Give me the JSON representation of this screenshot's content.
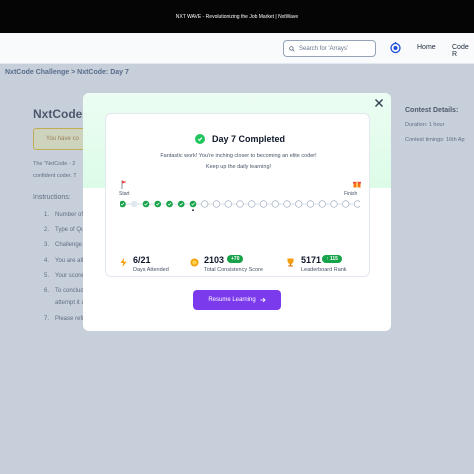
{
  "topbar": {
    "text": "NXT WAVE - Revolutionizing the Job Market | NxtWave"
  },
  "navbar": {
    "search_placeholder": "Search for 'Arrays'",
    "links": [
      "Home",
      "Code R"
    ]
  },
  "breadcrumb": "NxtCode Challenge > NxtCode: Day 7",
  "page": {
    "title": "NxtCode:",
    "notice": "You have co",
    "paragraph": [
      "The \"NxtCode - 2",
      "confident coder. T"
    ],
    "instructions_title": "Instructions:",
    "instructions": [
      {
        "n": "1.",
        "text": "Number of Qu"
      },
      {
        "n": "2.",
        "text": "Type of Ques"
      },
      {
        "n": "3.",
        "text": "Challenge Tim"
      },
      {
        "n": "4.",
        "text": "You are allow"
      },
      {
        "n": "5.",
        "text": "Your score wi"
      },
      {
        "n": "6.",
        "text": "To conclude t"
      },
      {
        "n": "",
        "text": "attempt it aga"
      },
      {
        "n": "7.",
        "text": "Please refrain"
      }
    ]
  },
  "contest": {
    "title": "Contest Details:",
    "duration": "Duration: 1 hour",
    "timings": "Contest timings: 16th Ap"
  },
  "modal": {
    "title": "Day 7 Completed",
    "subtitle_line1": "Fantastic work! You're inching closer to becoming an elite coder!",
    "subtitle_line2": "Keep up the daily learning!",
    "start_label": "Start",
    "finish_label": "Finish",
    "progress": {
      "completed_days": [
        1,
        3,
        4,
        5,
        6,
        7
      ],
      "current_day": 7,
      "total_days": 21
    },
    "stats": [
      {
        "value": "6/21",
        "label": "Days Attended",
        "badge": ""
      },
      {
        "value": "2103",
        "label": "Total Consistency Score",
        "badge": "+70"
      },
      {
        "value": "5171",
        "label": "Leaderboard Rank",
        "badge": "↑ 115"
      }
    ],
    "button_label": "Resume Learning",
    "colors": {
      "accent": "#7c3aed",
      "success": "#16a34a"
    }
  }
}
